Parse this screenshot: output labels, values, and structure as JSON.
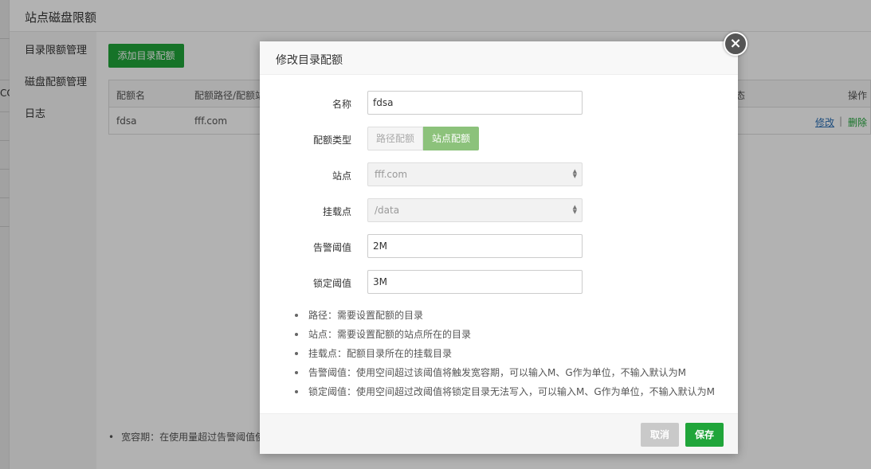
{
  "page": {
    "title": "站点磁盘限额"
  },
  "sidebar": {
    "items": [
      {
        "label": "目录限额管理"
      },
      {
        "label": "磁盘配额管理"
      },
      {
        "label": "日志"
      }
    ]
  },
  "left_strip": {
    "fragment": "CC"
  },
  "main": {
    "add_button": "添加目录配额",
    "table": {
      "headers": [
        "配额名",
        "配额路径/配额站",
        "态",
        "操作"
      ],
      "rows": [
        {
          "name": "fdsa",
          "path": "fff.com",
          "edit": "修改",
          "sep": "|",
          "delete": "删除"
        }
      ]
    },
    "bottom_note": "宽容期：在使用量超过告警阈值使"
  },
  "modal": {
    "title": "修改目录配额",
    "close_glyph": "×",
    "fields": {
      "name": {
        "label": "名称",
        "value": "fdsa"
      },
      "type": {
        "label": "配额类型",
        "options": [
          "路径配额",
          "站点配额"
        ],
        "selected": "站点配额"
      },
      "site": {
        "label": "站点",
        "value": "fff.com"
      },
      "mount": {
        "label": "挂载点",
        "value": "/data"
      },
      "warn": {
        "label": "告警阈值",
        "value": "2M"
      },
      "lock": {
        "label": "锁定阈值",
        "value": "3M"
      }
    },
    "help": [
      "路径：需要设置配额的目录",
      "站点：需要设置配额的站点所在的目录",
      "挂载点：配额目录所在的挂载目录",
      "告警阈值：使用空间超过该阈值将触发宽容期，可以输入M、G作为单位，不输入默认为M",
      "锁定阈值：使用空间超过改阈值将锁定目录无法写入，可以输入M、G作为单位，不输入默认为M"
    ],
    "cancel": "取消",
    "save": "保存"
  },
  "colors": {
    "primary": "#20a53a",
    "segment_active": "#8cc27b",
    "link": "#2b6fb5"
  },
  "icons": {
    "close": "close-icon",
    "select_arrows": "chevron-updown-icon"
  }
}
